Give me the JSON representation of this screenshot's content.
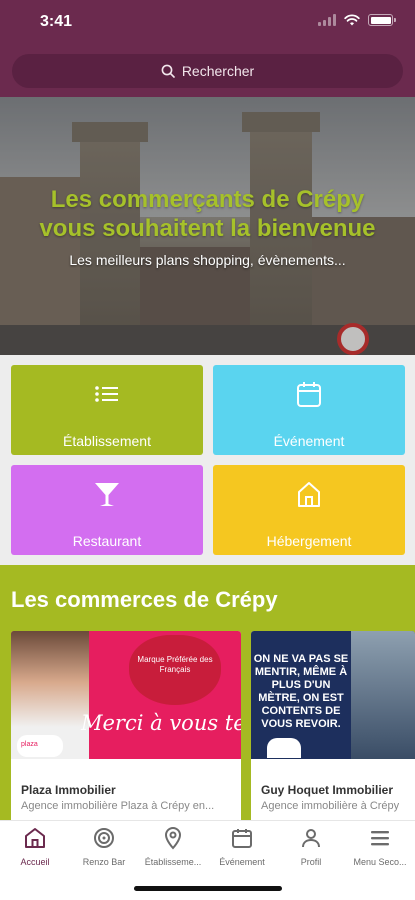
{
  "status": {
    "time": "3:41"
  },
  "search": {
    "label": "Rechercher"
  },
  "hero": {
    "title_line1": "Les commerçants de Crépy",
    "title_line2": "vous souhaitent la bienvenue",
    "subtitle": "Les meilleurs plans shopping, évènements..."
  },
  "categories": [
    {
      "label": "Établissement",
      "icon": "list-icon",
      "color": "#a5ba22"
    },
    {
      "label": "Événement",
      "icon": "calendar-icon",
      "color": "#5ad4ef"
    },
    {
      "label": "Restaurant",
      "icon": "cocktail-glass-icon",
      "color": "#d36ef0"
    },
    {
      "label": "Hébergement",
      "icon": "house-icon",
      "color": "#f5c720"
    }
  ],
  "commerces": {
    "title": "Les commerces de Crépy",
    "cards": [
      {
        "name": "Plaza Immobilier",
        "description": "Agence immobilière Plaza à Crépy en...",
        "image_text": "Merci à vous te",
        "image_badge": "Marque Préférée des Français",
        "logo_text": "plaza"
      },
      {
        "name": "Guy Hoquet Immobilier",
        "description": "Agence immobilière à Crépy",
        "image_text": "ON NE VA PAS SE MENTIR, MÊME À PLUS D'UN MÈTRE, ON EST CONTENTS DE VOUS REVOIR."
      }
    ]
  },
  "nav": {
    "items": [
      {
        "label": "Accueil",
        "icon": "home-icon",
        "active": true
      },
      {
        "label": "Renzo Bar",
        "icon": "target-icon",
        "active": false
      },
      {
        "label": "Établisseme...",
        "icon": "map-pin-icon",
        "active": false
      },
      {
        "label": "Événement",
        "icon": "calendar-icon",
        "active": false
      },
      {
        "label": "Profil",
        "icon": "user-icon",
        "active": false
      },
      {
        "label": "Menu Seco...",
        "icon": "menu-icon",
        "active": false
      }
    ]
  },
  "colors": {
    "brand": "#6b2a4e",
    "accent_green": "#a5ba22"
  }
}
